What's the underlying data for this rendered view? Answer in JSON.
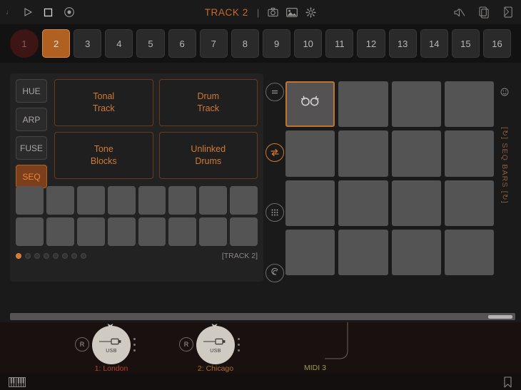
{
  "header": {
    "title": "TRACK 2",
    "divider": "|",
    "left_icons": [
      {
        "name": "play-icon",
        "label": "Play"
      },
      {
        "name": "stop-icon",
        "label": "Stop"
      },
      {
        "name": "record-icon",
        "label": "Record"
      }
    ],
    "center_icons": [
      {
        "name": "camera-icon",
        "label": "Snapshot"
      },
      {
        "name": "image-icon",
        "label": "Image"
      },
      {
        "name": "gear-icon",
        "label": "Settings"
      }
    ],
    "right_icons": [
      {
        "name": "mute-icon",
        "label": "Mute"
      },
      {
        "name": "copy-icon",
        "label": "Copy"
      },
      {
        "name": "paste-icon",
        "label": "Paste"
      }
    ]
  },
  "tracks": {
    "buttons": [
      "1",
      "2",
      "3",
      "4",
      "5",
      "6",
      "7",
      "8",
      "9",
      "10",
      "11",
      "12",
      "13",
      "14",
      "15",
      "16"
    ],
    "active_index": 1,
    "circle_index": 0
  },
  "panel": {
    "modes": [
      {
        "label": "HUE",
        "active": false
      },
      {
        "label": "ARP",
        "active": false
      },
      {
        "label": "FUSE",
        "active": false
      },
      {
        "label": "SEQ",
        "active": true
      }
    ],
    "blocks": [
      {
        "line1": "Tonal",
        "line2": "Track"
      },
      {
        "line1": "Drum",
        "line2": "Track"
      },
      {
        "line1": "Tone",
        "line2": "Blocks"
      },
      {
        "line1": "Unlinked",
        "line2": "Drums"
      }
    ],
    "small_pad_count": 16,
    "page_dot_count": 8,
    "page_dot_active": 0,
    "footer_label": "[TRACK 2]"
  },
  "tools": [
    {
      "name": "equals-icon",
      "label": "Equals",
      "accent": false
    },
    {
      "name": "swap-arrows-icon",
      "label": "Swap",
      "accent": true
    },
    {
      "name": "grid-dots-icon",
      "label": "Grid",
      "accent": false
    },
    {
      "name": "spiral-icon",
      "label": "Spiral",
      "accent": false
    }
  ],
  "big_grid": {
    "pad_count": 16,
    "selected_index": 0,
    "selected_icon": "loop-arrows-icon"
  },
  "right_rail": {
    "icon": "smiley-icon",
    "text": "[↻] SEQ BARS [↻]"
  },
  "devices": [
    {
      "badge": "R",
      "knob_label": "USB",
      "label": "1: London",
      "color": "#b5402f"
    },
    {
      "badge": "R",
      "knob_label": "USB",
      "label": "2: Chicago",
      "color": "#b06a2c"
    }
  ],
  "midi": {
    "label": "MIDI 3"
  },
  "statusbar": {
    "left_icon": "piano-keys-icon",
    "right_icon": "bookmark-icon"
  },
  "colors": {
    "accent": "#cf7a36",
    "active_bg": "#b06020",
    "panel_bg": "#232222",
    "pad": "#555454"
  }
}
